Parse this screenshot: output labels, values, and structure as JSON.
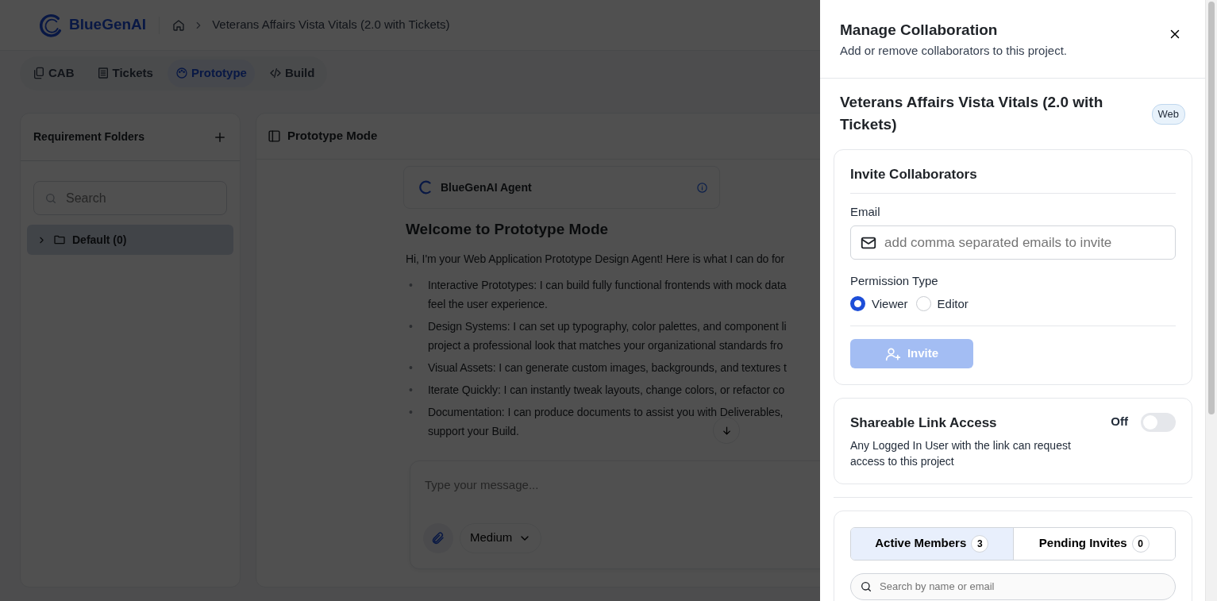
{
  "header": {
    "brand": "BlueGenAI",
    "breadcrumb": "Veterans Affairs Vista Vitals (2.0 with Tickets)"
  },
  "tabs": [
    {
      "label": "CAB",
      "selected": false
    },
    {
      "label": "Tickets",
      "selected": false
    },
    {
      "label": "Prototype",
      "selected": true
    },
    {
      "label": "Build",
      "selected": false
    }
  ],
  "sidebar": {
    "title": "Requirement Folders",
    "search": {
      "placeholder": "Search"
    },
    "folders": [
      {
        "label": "Default (0)",
        "expanded": false,
        "selected": true
      }
    ]
  },
  "main": {
    "title": "Prototype Mode",
    "agent": {
      "name": "BlueGenAI Agent"
    },
    "heading": "Welcome to Prototype Mode",
    "intro": "Hi, I'm your Web Application Prototype Design Agent! Here is what I can do for",
    "bullets": [
      {
        "marker": "•",
        "lines": [
          "Interactive Prototypes: I can build fully functional frontends with mock data",
          "feel the user experience."
        ]
      },
      {
        "marker": "•",
        "lines": [
          "Design Systems: I can set up typography, color palettes, and component li",
          "project a professional look that matches your organizational standards fro"
        ]
      },
      {
        "marker": "•",
        "lines": [
          "Visual Assets: I can generate custom images, backgrounds, and textures t"
        ]
      },
      {
        "marker": "•",
        "lines": [
          "Iterate Quickly: I can instantly tweak layouts, change colors, or refactor co"
        ]
      },
      {
        "marker": "•",
        "lines": [
          "Documentation: I can produce documents to assist you with Deliverables,",
          "support your Build."
        ]
      }
    ],
    "composer": {
      "placeholder": "Type your message...",
      "effort": "Medium"
    }
  },
  "drawer": {
    "title": "Manage Collaboration",
    "subtitle": "Add or remove collaborators to this project.",
    "project": {
      "name": "Veterans Affairs Vista Vitals (2.0 with Tickets)",
      "badge": "Web"
    },
    "invite": {
      "title": "Invite Collaborators",
      "email_label": "Email",
      "email": {
        "placeholder": "add comma separated emails to invite"
      },
      "permission_label": "Permission Type",
      "permissions": [
        {
          "label": "Viewer",
          "selected": true
        },
        {
          "label": "Editor",
          "selected": false
        }
      ],
      "button": {
        "label": "Invite",
        "disabled": true
      }
    },
    "share": {
      "title": "Shareable Link Access",
      "description": "Any Logged In User with the link can request access to this project",
      "state": "Off",
      "on": false
    },
    "members": {
      "tabs": [
        {
          "label": "Active Members",
          "count": "3",
          "selected": true
        },
        {
          "label": "Pending Invites",
          "count": "0",
          "selected": false
        }
      ],
      "search": {
        "placeholder": "Search by name or email"
      }
    }
  }
}
